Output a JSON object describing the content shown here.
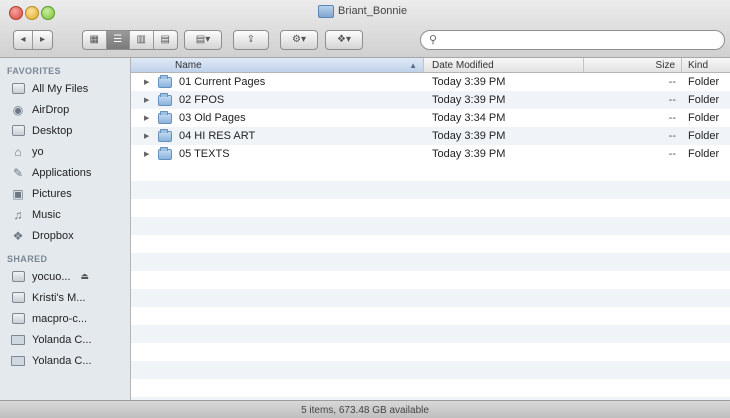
{
  "window": {
    "title": "Briant_Bonnie"
  },
  "toolbar": {
    "back_glyph": "◂",
    "forward_glyph": "▸",
    "view_icon_glyph": "▦",
    "view_list_glyph": "☰",
    "view_column_glyph": "▥",
    "view_coverflow_glyph": "▤",
    "arrange_glyph": "▤▾",
    "share_glyph": "⇪",
    "action_glyph": "⚙▾",
    "dropbox_glyph": "❖▾",
    "search_placeholder": ""
  },
  "sidebar": {
    "favorites_heading": "FAVORITES",
    "favorites": [
      {
        "label": "All My Files",
        "icon": "all-files-icon"
      },
      {
        "label": "AirDrop",
        "icon": "airdrop-icon"
      },
      {
        "label": "Desktop",
        "icon": "desktop-icon"
      },
      {
        "label": "yo",
        "icon": "home-icon"
      },
      {
        "label": "Applications",
        "icon": "applications-icon"
      },
      {
        "label": "Pictures",
        "icon": "pictures-icon"
      },
      {
        "label": "Music",
        "icon": "music-icon"
      },
      {
        "label": "Dropbox",
        "icon": "dropbox-icon"
      }
    ],
    "shared_heading": "SHARED",
    "shared": [
      {
        "label": "yocuo...",
        "icon": "shared-computer-icon"
      },
      {
        "label": "Kristi's M...",
        "icon": "shared-computer-icon"
      },
      {
        "label": "macpro-c...",
        "icon": "shared-computer-icon"
      },
      {
        "label": "Yolanda C...",
        "icon": "shared-display-icon"
      },
      {
        "label": "Yolanda C...",
        "icon": "shared-display-icon"
      }
    ]
  },
  "columns": {
    "name": "Name",
    "date": "Date Modified",
    "size": "Size",
    "kind": "Kind"
  },
  "rows": [
    {
      "name": "01 Current Pages",
      "date": "Today 3:39 PM",
      "size": "--",
      "kind": "Folder"
    },
    {
      "name": "02 FPOS",
      "date": "Today 3:39 PM",
      "size": "--",
      "kind": "Folder"
    },
    {
      "name": "03 Old Pages",
      "date": "Today 3:34 PM",
      "size": "--",
      "kind": "Folder"
    },
    {
      "name": "04 HI RES ART",
      "date": "Today 3:39 PM",
      "size": "--",
      "kind": "Folder"
    },
    {
      "name": "05 TEXTS",
      "date": "Today 3:39 PM",
      "size": "--",
      "kind": "Folder"
    }
  ],
  "status": {
    "text": "5 items, 673.48 GB available"
  }
}
